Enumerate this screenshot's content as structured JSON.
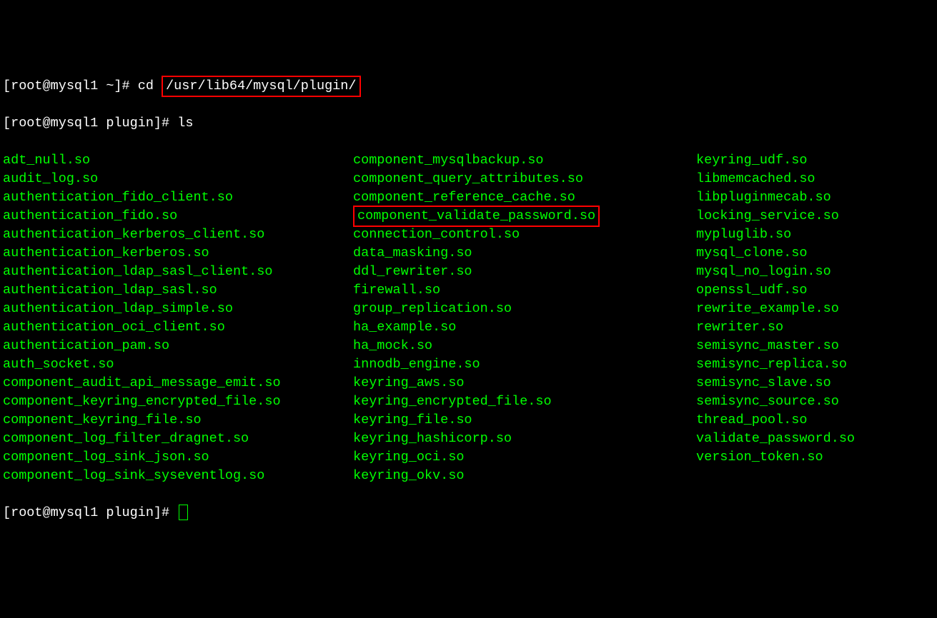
{
  "lines": {
    "prompt1_user": "[root@mysql1 ~]# ",
    "prompt1_cmd": "cd ",
    "prompt1_path": "/usr/lib64/mysql/plugin/",
    "prompt2_user": "[root@mysql1 plugin]# ",
    "prompt2_cmd": "ls",
    "prompt3_user": "[root@mysql1 plugin]# "
  },
  "columns": {
    "col1": [
      "adt_null.so",
      "audit_log.so",
      "authentication_fido_client.so",
      "authentication_fido.so",
      "authentication_kerberos_client.so",
      "authentication_kerberos.so",
      "authentication_ldap_sasl_client.so",
      "authentication_ldap_sasl.so",
      "authentication_ldap_simple.so",
      "authentication_oci_client.so",
      "authentication_pam.so",
      "auth_socket.so",
      "component_audit_api_message_emit.so",
      "component_keyring_encrypted_file.so",
      "component_keyring_file.so",
      "component_log_filter_dragnet.so",
      "component_log_sink_json.so",
      "component_log_sink_syseventlog.so"
    ],
    "col2": [
      "component_mysqlbackup.so",
      "component_query_attributes.so",
      "component_reference_cache.so",
      "component_validate_password.so",
      "connection_control.so",
      "data_masking.so",
      "ddl_rewriter.so",
      "firewall.so",
      "group_replication.so",
      "ha_example.so",
      "ha_mock.so",
      "innodb_engine.so",
      "keyring_aws.so",
      "keyring_encrypted_file.so",
      "keyring_file.so",
      "keyring_hashicorp.so",
      "keyring_oci.so",
      "keyring_okv.so"
    ],
    "col3": [
      "keyring_udf.so",
      "libmemcached.so",
      "libpluginmecab.so",
      "locking_service.so",
      "mypluglib.so",
      "mysql_clone.so",
      "mysql_no_login.so",
      "openssl_udf.so",
      "rewrite_example.so",
      "rewriter.so",
      "semisync_master.so",
      "semisync_replica.so",
      "semisync_slave.so",
      "semisync_source.so",
      "thread_pool.so",
      "validate_password.so",
      "version_token.so"
    ]
  },
  "highlighted_col2_index": 3
}
